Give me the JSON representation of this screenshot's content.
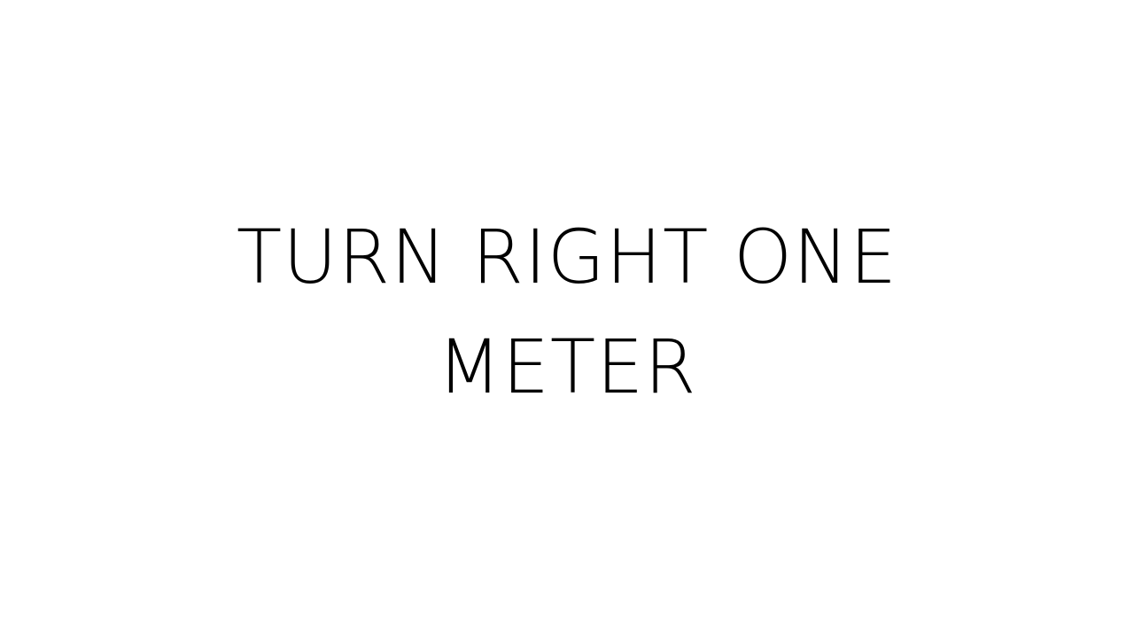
{
  "slide": {
    "title_lines": [
      "TURN RIGHT ONE",
      "METER"
    ],
    "text_color": "#000000",
    "background_color": "#ffffff"
  }
}
